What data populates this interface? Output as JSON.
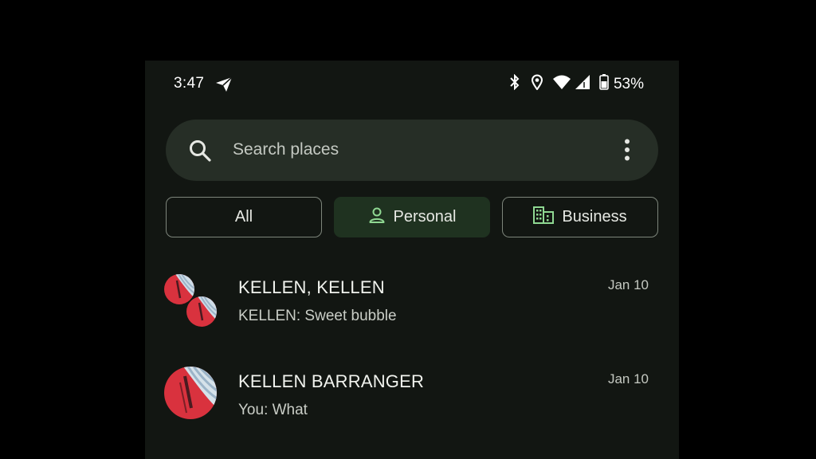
{
  "status_bar": {
    "time": "3:47",
    "battery_percent": "53%",
    "icons": [
      "send-icon",
      "bluetooth-icon",
      "location-icon",
      "wifi-icon",
      "signal-icon",
      "battery-icon"
    ]
  },
  "search": {
    "placeholder": "Search places"
  },
  "filters": {
    "all": "All",
    "personal": "Personal",
    "business": "Business",
    "selected": "Personal"
  },
  "conversations": [
    {
      "name": "KELLEN, KELLEN",
      "preview": "KELLEN: Sweet bubble",
      "date": "Jan 10",
      "avatar": "group-avatar"
    },
    {
      "name": "KELLEN BARRANGER",
      "preview": "You: What",
      "date": "Jan 10",
      "avatar": "contact-avatar"
    }
  ],
  "colors": {
    "background": "#121612",
    "search_bg": "#262e26",
    "selected_chip_bg": "#1f3220",
    "accent_green": "#8fd892",
    "avatar_red": "#d9323e"
  }
}
